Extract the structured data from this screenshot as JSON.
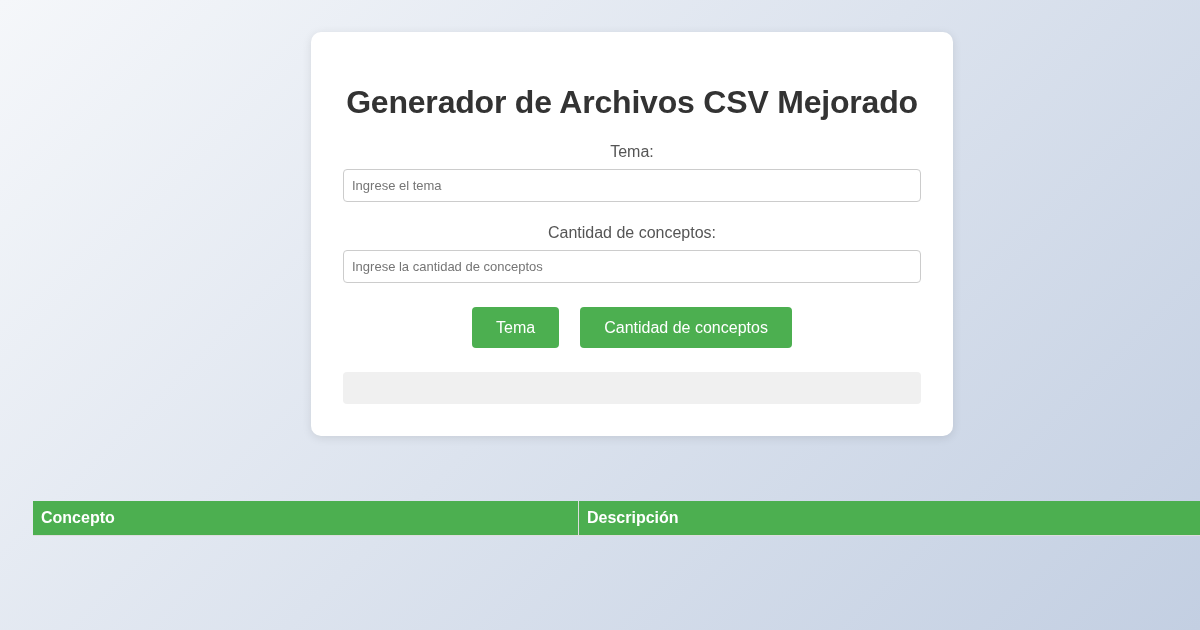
{
  "form": {
    "title": "Generador de Archivos CSV Mejorado",
    "fields": [
      {
        "label": "Tema:",
        "placeholder": "Ingrese el tema"
      },
      {
        "label": "Cantidad de conceptos:",
        "placeholder": "Ingrese la cantidad de conceptos"
      }
    ],
    "buttons": [
      "Tema",
      "Cantidad de conceptos"
    ]
  },
  "table": {
    "columns": [
      "Concepto",
      "Descripción"
    ]
  }
}
